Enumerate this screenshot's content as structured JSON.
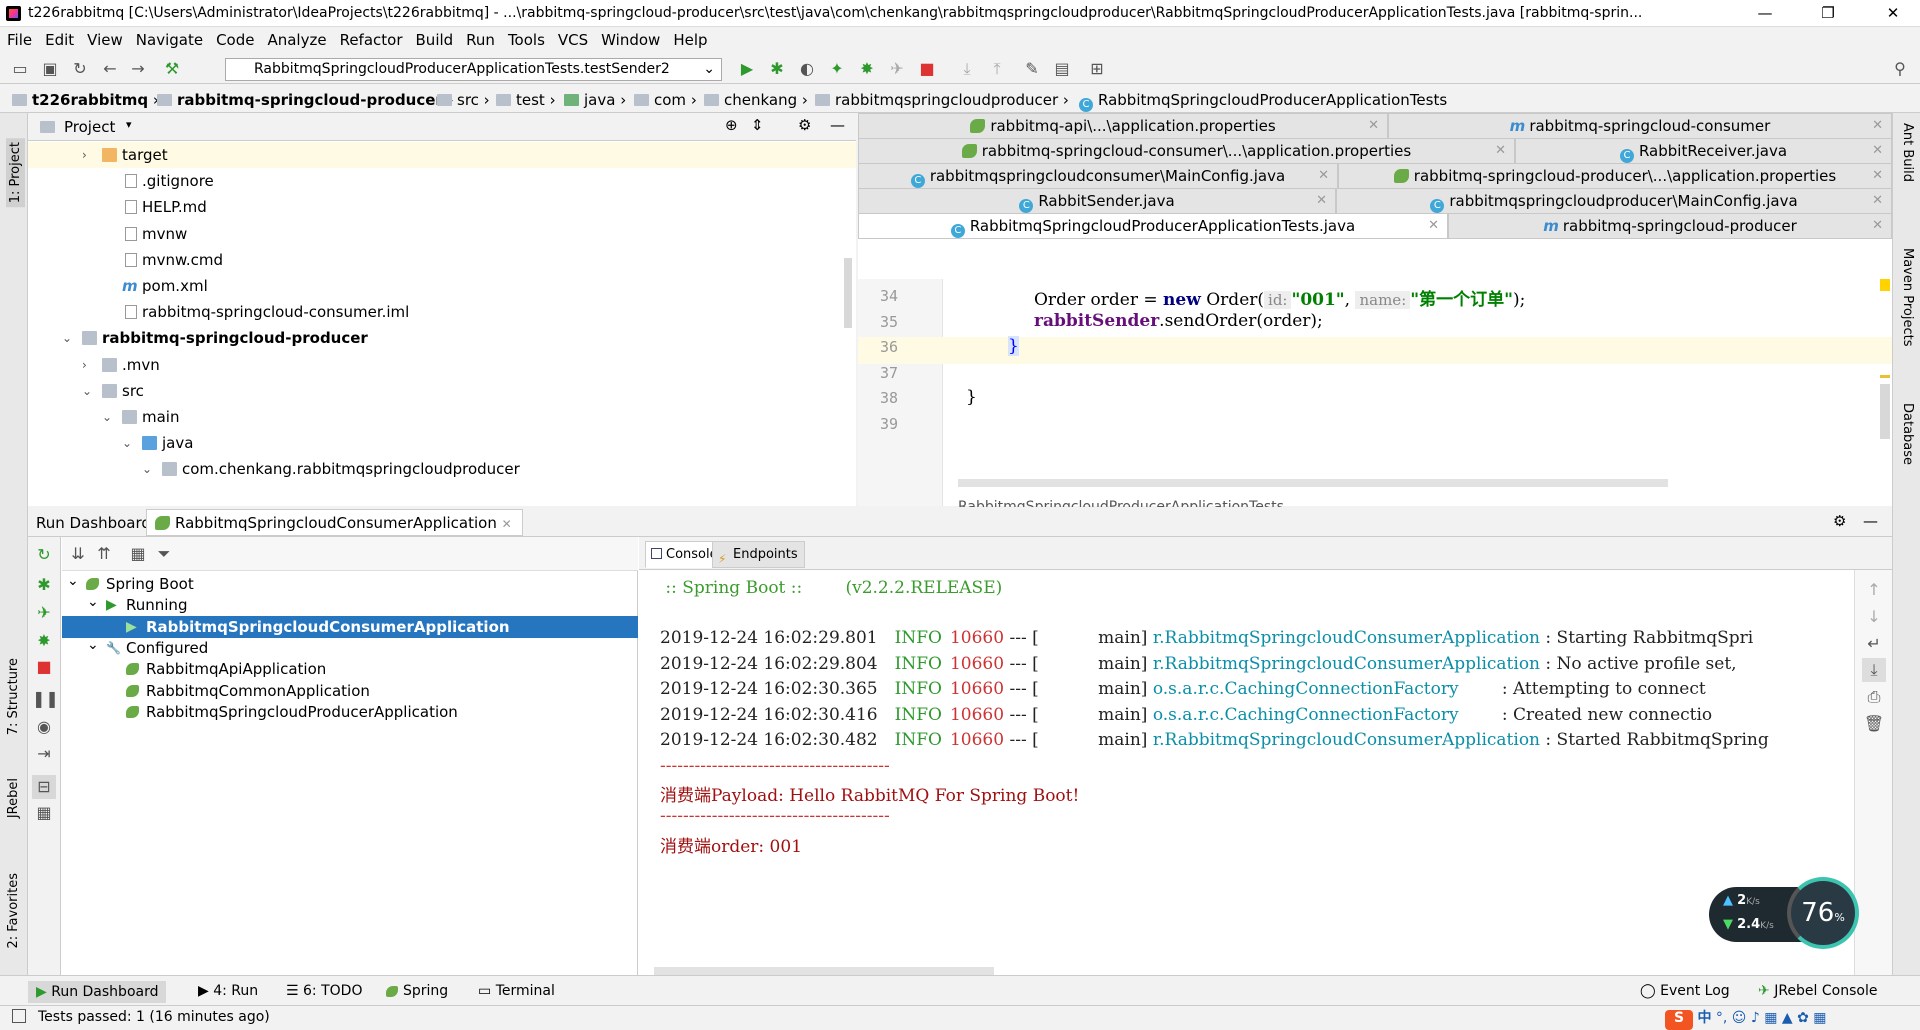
{
  "window": {
    "title": "t226rabbitmq [C:\\Users\\Administrator\\IdeaProjects\\t226rabbitmq] - ...\\rabbitmq-springcloud-producer\\src\\test\\java\\com\\chenkang\\rabbitmqspringcloudproducer\\RabbitmqSpringcloudProducerApplicationTests.java [rabbitmq-sprin...",
    "minimize": "—",
    "maximize": "❐",
    "close": "✕"
  },
  "menu": [
    "File",
    "Edit",
    "View",
    "Navigate",
    "Code",
    "Analyze",
    "Refactor",
    "Build",
    "Run",
    "Tools",
    "VCS",
    "Window",
    "Help"
  ],
  "toolbar": {
    "run_config": "RabbitmqSpringcloudProducerApplicationTests.testSender2"
  },
  "breadcrumb": [
    "t226rabbitmq",
    "rabbitmq-springcloud-producer",
    "src",
    "test",
    "java",
    "com",
    "chenkang",
    "rabbitmqspringcloudproducer",
    "RabbitmqSpringcloudProducerApplicationTests"
  ],
  "project": {
    "header": "Project",
    "items": [
      {
        "label": "target",
        "indent": 2,
        "arrow": "›",
        "kind": "folder"
      },
      {
        "label": ".gitignore",
        "indent": 3,
        "arrow": "",
        "kind": "file"
      },
      {
        "label": "HELP.md",
        "indent": 3,
        "arrow": "",
        "kind": "file"
      },
      {
        "label": "mvnw",
        "indent": 3,
        "arrow": "",
        "kind": "file"
      },
      {
        "label": "mvnw.cmd",
        "indent": 3,
        "arrow": "",
        "kind": "file"
      },
      {
        "label": "pom.xml",
        "indent": 3,
        "arrow": "",
        "kind": "maven"
      },
      {
        "label": "rabbitmq-springcloud-consumer.iml",
        "indent": 3,
        "arrow": "",
        "kind": "file"
      },
      {
        "label": "rabbitmq-springcloud-producer",
        "indent": 1,
        "arrow": "⌄",
        "kind": "module",
        "bold": true
      },
      {
        "label": ".mvn",
        "indent": 2,
        "arrow": "›",
        "kind": "gfolder"
      },
      {
        "label": "src",
        "indent": 2,
        "arrow": "⌄",
        "kind": "gfolder"
      },
      {
        "label": "main",
        "indent": 3,
        "arrow": "⌄",
        "kind": "gfolder"
      },
      {
        "label": "java",
        "indent": 4,
        "arrow": "⌄",
        "kind": "bfolder"
      },
      {
        "label": "com.chenkang.rabbitmqspringcloudproducer",
        "indent": 5,
        "arrow": "⌄",
        "kind": "pfolder"
      }
    ]
  },
  "editor_tabs": {
    "row1": [
      {
        "label": "rabbitmq-api\\...\\application.properties",
        "kind": "prop"
      },
      {
        "label": "rabbitmq-springcloud-consumer",
        "kind": "maven"
      }
    ],
    "row2": [
      {
        "label": "rabbitmq-springcloud-consumer\\...\\application.properties",
        "kind": "prop"
      },
      {
        "label": "RabbitReceiver.java",
        "kind": "java"
      }
    ],
    "row3": [
      {
        "label": "rabbitmqspringcloudconsumer\\MainConfig.java",
        "kind": "java"
      },
      {
        "label": "rabbitmq-springcloud-producer\\...\\application.properties",
        "kind": "prop"
      }
    ],
    "row4": [
      {
        "label": "RabbitSender.java",
        "kind": "java"
      },
      {
        "label": "rabbitmqspringcloudproducer\\MainConfig.java",
        "kind": "java"
      }
    ],
    "row5": [
      {
        "label": "RabbitmqSpringcloudProducerApplicationTests.java",
        "kind": "java"
      },
      {
        "label": "rabbitmq-springcloud-producer",
        "kind": "maven"
      }
    ]
  },
  "code": {
    "lines": [
      {
        "n": "34",
        "t1": "Order order = ",
        "kw": "new",
        "t2": " Order(",
        "h1": "id:",
        "s1": "\"001\"",
        "t3": ",  ",
        "h2": "name:",
        "s2": "\"第一个订单\"",
        "t4": ");"
      },
      {
        "n": "35",
        "field": "rabbitSender",
        "t1": ".sendOrder(order);"
      },
      {
        "n": "36",
        "t1": "}"
      },
      {
        "n": "37",
        "t1": ""
      },
      {
        "n": "38",
        "t1": "}"
      },
      {
        "n": "39",
        "t1": ""
      }
    ],
    "footer": "RabbitmqSpringcloudProducerApplicationTests"
  },
  "run_dashboard": {
    "label": "Run Dashboard:",
    "tab": "RabbitmqSpringcloudConsumerApplication",
    "tree": [
      {
        "label": "Spring Boot",
        "indent": 0
      },
      {
        "label": "Running",
        "indent": 1
      },
      {
        "label": "RabbitmqSpringcloudConsumerApplication",
        "indent": 2,
        "selected": true
      },
      {
        "label": "Configured",
        "indent": 1
      },
      {
        "label": "RabbitmqApiApplication",
        "indent": 2
      },
      {
        "label": "RabbitmqCommonApplication",
        "indent": 2
      },
      {
        "label": "RabbitmqSpringcloudProducerApplication",
        "indent": 2
      }
    ],
    "console_tabs": [
      "Console",
      "Endpoints"
    ],
    "console": {
      "banner": " :: Spring Boot ::        (v2.2.2.RELEASE)",
      "logs": [
        {
          "ts": "2019-12-24 16:02:29.801",
          "lvl": "INFO",
          "pid": "10660",
          "mid": " --- [           main] ",
          "src": "r.RabbitmqSpringcloudConsumerApplication",
          "msg": " : Starting RabbitmqSpri"
        },
        {
          "ts": "2019-12-24 16:02:29.804",
          "lvl": "INFO",
          "pid": "10660",
          "mid": " --- [           main] ",
          "src": "r.RabbitmqSpringcloudConsumerApplication",
          "msg": " : No active profile set,"
        },
        {
          "ts": "2019-12-24 16:02:30.365",
          "lvl": "INFO",
          "pid": "10660",
          "mid": " --- [           main] ",
          "src": "o.s.a.r.c.CachingConnectionFactory      ",
          "msg": "  : Attempting to connect"
        },
        {
          "ts": "2019-12-24 16:02:30.416",
          "lvl": "INFO",
          "pid": "10660",
          "mid": " --- [           main] ",
          "src": "o.s.a.r.c.CachingConnectionFactory      ",
          "msg": "  : Created new connectio"
        },
        {
          "ts": "2019-12-24 16:02:30.482",
          "lvl": "INFO",
          "pid": "10660",
          "mid": " --- [           main] ",
          "src": "r.RabbitmqSpringcloudConsumerApplication",
          "msg": " : Started RabbitmqSpring"
        }
      ],
      "sep": "----------------------------------------",
      "payload": "消费端Payload: Hello RabbitMQ For Spring Boot!",
      "order": "消费端order: 001"
    }
  },
  "net_widget": {
    "up": "2",
    "up_unit": "K/s",
    "down": "2.4",
    "down_unit": "K/s",
    "percent": "76",
    "pct": "%"
  },
  "bottom_tabs": [
    "Run Dashboard",
    "4: Run",
    "6: TODO",
    "Spring",
    "Terminal"
  ],
  "bottom_right": [
    "Event Log",
    "JRebel Console"
  ],
  "left_strip": [
    "1: Project",
    "7: Structure",
    "JRebel",
    "2: Favorites"
  ],
  "right_strip": [
    "Ant Build",
    "Maven Projects",
    "Database"
  ],
  "status": "Tests passed: 1 (16 minutes ago)",
  "tray": "中"
}
